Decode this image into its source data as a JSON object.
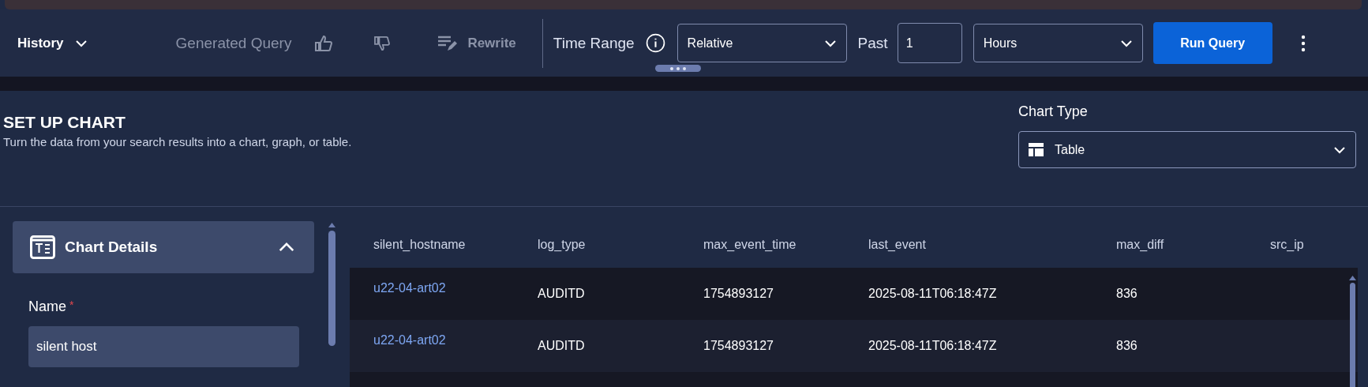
{
  "toolbar": {
    "history": "History",
    "generated_query": "Generated Query",
    "rewrite": "Rewrite",
    "time_range_label": "Time Range",
    "range_mode": "Relative",
    "past_label": "Past",
    "past_value": "1",
    "unit": "Hours",
    "run_button": "Run Query"
  },
  "setup": {
    "title": "SET UP CHART",
    "subtitle": "Turn the data from your search results into a chart, graph, or table.",
    "chart_type_label": "Chart Type",
    "chart_type": "Table"
  },
  "details": {
    "title": "Chart Details",
    "expanded": true,
    "name_label": "Name",
    "required_mark": "*",
    "name_value": "silent host"
  },
  "table": {
    "columns": [
      "silent_hostname",
      "log_type",
      "max_event_time",
      "last_event",
      "max_diff",
      "src_ip"
    ],
    "rows": [
      {
        "cells": [
          "u22-04-art02",
          "AUDITD",
          "1754893127",
          "2025-08-11T06:18:47Z",
          "836"
        ]
      },
      {
        "cells": [
          "u22-04-art02",
          "AUDITD",
          "1754893127",
          "2025-08-11T06:18:47Z",
          "836"
        ]
      }
    ]
  }
}
